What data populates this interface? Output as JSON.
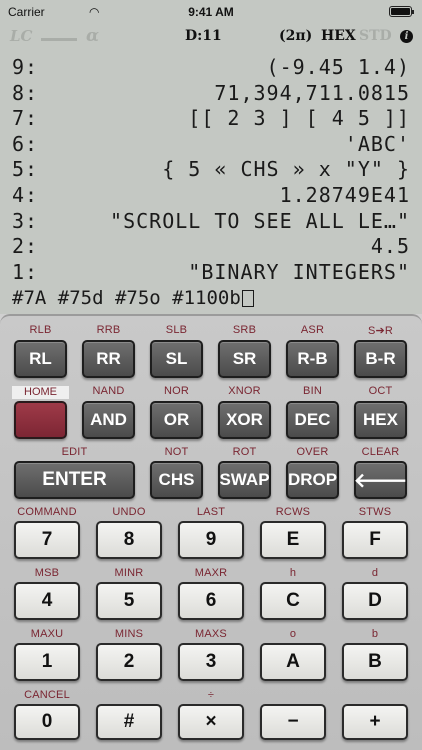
{
  "status": {
    "carrier": "Carrier",
    "time": "9:41 AM"
  },
  "annunciators": {
    "lc": "LC",
    "alpha": "α",
    "dir": "D:11",
    "twopi": "(2π)",
    "base": "HEX",
    "std": "STD",
    "info": "i"
  },
  "stack": [
    {
      "level": "9:",
      "value": "(-9.45 1.4)"
    },
    {
      "level": "8:",
      "value": "71,394,711.0815"
    },
    {
      "level": "7:",
      "value": "[[ 2 3 ] [ 4 5 ]]"
    },
    {
      "level": "6:",
      "value": "'ABC'"
    },
    {
      "level": "5:",
      "value": "{ 5 « CHS » x \"Y\" }"
    },
    {
      "level": "4:",
      "value": "1.28749E41"
    },
    {
      "level": "3:",
      "value": "\"SCROLL TO SEE ALL LE…\""
    },
    {
      "level": "2:",
      "value": "4.5"
    },
    {
      "level": "1:",
      "value": "\"BINARY INTEGERS\""
    }
  ],
  "command_line": "#7A #75d #75o #1100b",
  "rows": [
    {
      "keys": [
        {
          "shift": "RLB",
          "label": "RL"
        },
        {
          "shift": "RRB",
          "label": "RR"
        },
        {
          "shift": "SLB",
          "label": "SL"
        },
        {
          "shift": "SRB",
          "label": "SR"
        },
        {
          "shift": "ASR",
          "label": "R-B"
        },
        {
          "shift": "S➔R",
          "label": "B-R"
        }
      ]
    },
    {
      "keys": [
        {
          "shift": "HOME",
          "label": ""
        },
        {
          "shift": "NAND",
          "label": "AND"
        },
        {
          "shift": "NOR",
          "label": "OR"
        },
        {
          "shift": "XNOR",
          "label": "XOR"
        },
        {
          "shift": "BIN",
          "label": "DEC"
        },
        {
          "shift": "OCT",
          "label": "HEX"
        }
      ]
    },
    {
      "keys": [
        {
          "shift": "EDIT",
          "label": "ENTER"
        },
        {
          "shift": "NOT",
          "label": "CHS"
        },
        {
          "shift": "ROT",
          "label": "SWAP"
        },
        {
          "shift": "OVER",
          "label": "DROP"
        },
        {
          "shift": "CLEAR",
          "label": "🡐"
        }
      ]
    },
    {
      "keys": [
        {
          "shift": "COMMAND",
          "label": "7"
        },
        {
          "shift": "UNDO",
          "label": "8"
        },
        {
          "shift": "LAST",
          "label": "9"
        },
        {
          "shift": "RCWS",
          "label": "E"
        },
        {
          "shift": "STWS",
          "label": "F"
        }
      ]
    },
    {
      "keys": [
        {
          "shift": "MSB",
          "label": "4"
        },
        {
          "shift": "MINR",
          "label": "5"
        },
        {
          "shift": "MAXR",
          "label": "6"
        },
        {
          "shift": "h",
          "label": "C"
        },
        {
          "shift": "d",
          "label": "D"
        }
      ]
    },
    {
      "keys": [
        {
          "shift": "MAXU",
          "label": "1"
        },
        {
          "shift": "MINS",
          "label": "2"
        },
        {
          "shift": "MAXS",
          "label": "3"
        },
        {
          "shift": "o",
          "label": "A"
        },
        {
          "shift": "b",
          "label": "B"
        }
      ]
    },
    {
      "keys": [
        {
          "shift": "CANCEL",
          "label": "0"
        },
        {
          "shift": "",
          "label": "#"
        },
        {
          "shift": "÷",
          "label": "×"
        },
        {
          "shift": "",
          "label": "−"
        },
        {
          "shift": "",
          "label": "+"
        }
      ]
    }
  ]
}
